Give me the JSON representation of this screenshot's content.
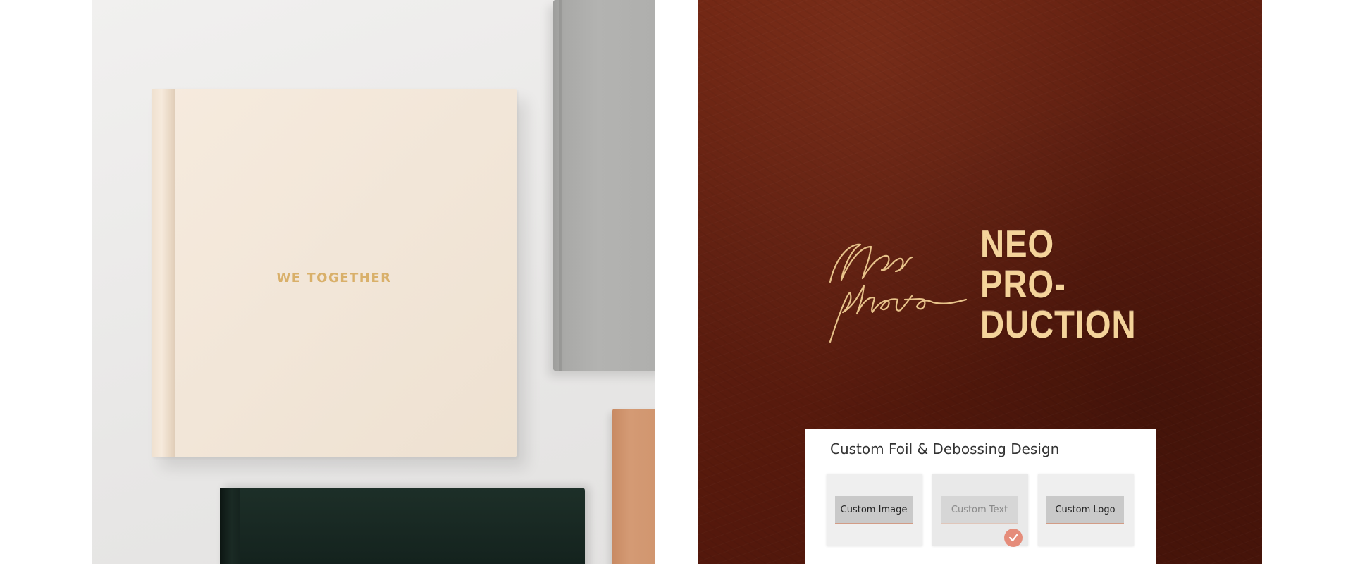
{
  "left_photo": {
    "album_title": "WE TOGETHER"
  },
  "right_photo": {
    "signature_lines": [
      "Neo",
      "photo"
    ],
    "block_logo_lines": [
      "NEO",
      "PRO-",
      "DUCTION"
    ],
    "panel": {
      "title": "Custom Foil & Debossing Design",
      "options": [
        {
          "label": "Custom Image",
          "selected": false
        },
        {
          "label": "Custom Text",
          "selected": true
        },
        {
          "label": "Custom Logo",
          "selected": false
        }
      ]
    }
  },
  "colors": {
    "foil_gold": "#f4d39a",
    "leather_brown": "#5e1e10",
    "cream_cover": "#f2e6d8",
    "check_accent": "#e58c7a"
  },
  "icons": {
    "selected_marker": "check-circle-icon"
  }
}
